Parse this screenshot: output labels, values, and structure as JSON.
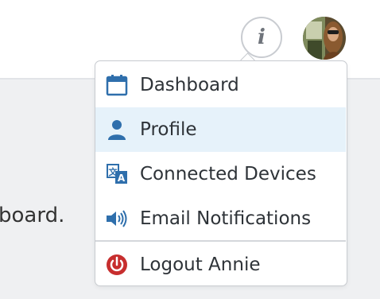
{
  "body": {
    "partial_text": "board."
  },
  "header": {
    "info_button_glyph": "i",
    "avatar_alt": "User avatar"
  },
  "menu": {
    "items": [
      {
        "label": "Dashboard",
        "icon": "calendar-icon",
        "active": false
      },
      {
        "label": "Profile",
        "icon": "user-icon",
        "active": true
      },
      {
        "label": "Connected Devices",
        "icon": "translate-icon",
        "active": false
      },
      {
        "label": "Email Notifications",
        "icon": "speaker-icon",
        "active": false
      }
    ],
    "logout": {
      "label": "Logout Annie",
      "icon": "power-icon"
    }
  },
  "colors": {
    "icon_blue": "#2f6fac",
    "logout_red": "#c72e2e",
    "active_bg": "#e6f2fa"
  }
}
